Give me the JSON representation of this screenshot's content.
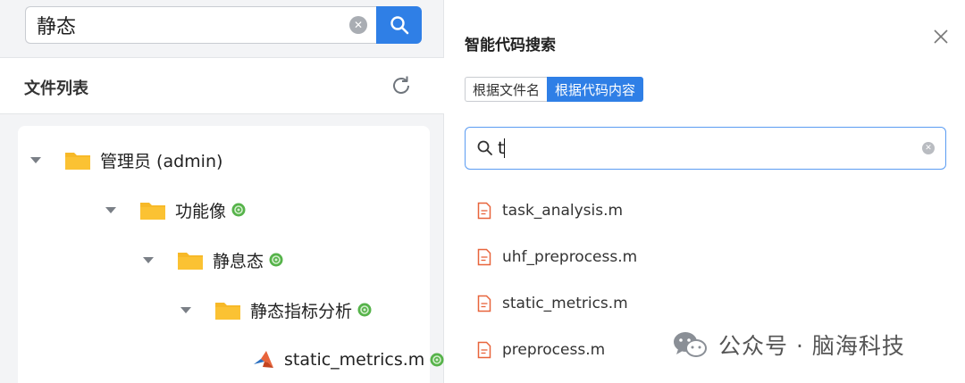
{
  "search": {
    "query": "静态"
  },
  "file_list": {
    "title": "文件列表"
  },
  "tree": [
    {
      "label": "管理员 (admin)",
      "kind": "folder",
      "expanded": true,
      "badge": false
    },
    {
      "label": "功能像",
      "kind": "folder",
      "expanded": true,
      "badge": true
    },
    {
      "label": "静息态",
      "kind": "folder",
      "expanded": true,
      "badge": true
    },
    {
      "label": "静态指标分析",
      "kind": "folder",
      "expanded": true,
      "badge": true
    },
    {
      "label": "static_metrics.m",
      "kind": "matlab-file",
      "badge": true
    }
  ],
  "code_search_panel": {
    "title": "智能代码搜索",
    "tabs": [
      {
        "label": "根据文件名",
        "active": false
      },
      {
        "label": "根据代码内容",
        "active": true
      }
    ],
    "query": "t",
    "results": [
      "task_analysis.m",
      "uhf_preprocess.m",
      "static_metrics.m",
      "preprocess.m"
    ]
  },
  "watermark": {
    "text": "公众号 · 脑海科技"
  },
  "colors": {
    "accent": "#2f7fe6",
    "folder": "#f7b928",
    "git_badge": "#56b34a",
    "doc_icon": "#e8643b"
  },
  "icons": [
    "search-icon",
    "clear-icon",
    "refresh-icon",
    "caret-down-icon",
    "folder-icon",
    "git-badge-icon",
    "matlab-icon",
    "close-icon",
    "document-icon",
    "wechat-icon"
  ]
}
